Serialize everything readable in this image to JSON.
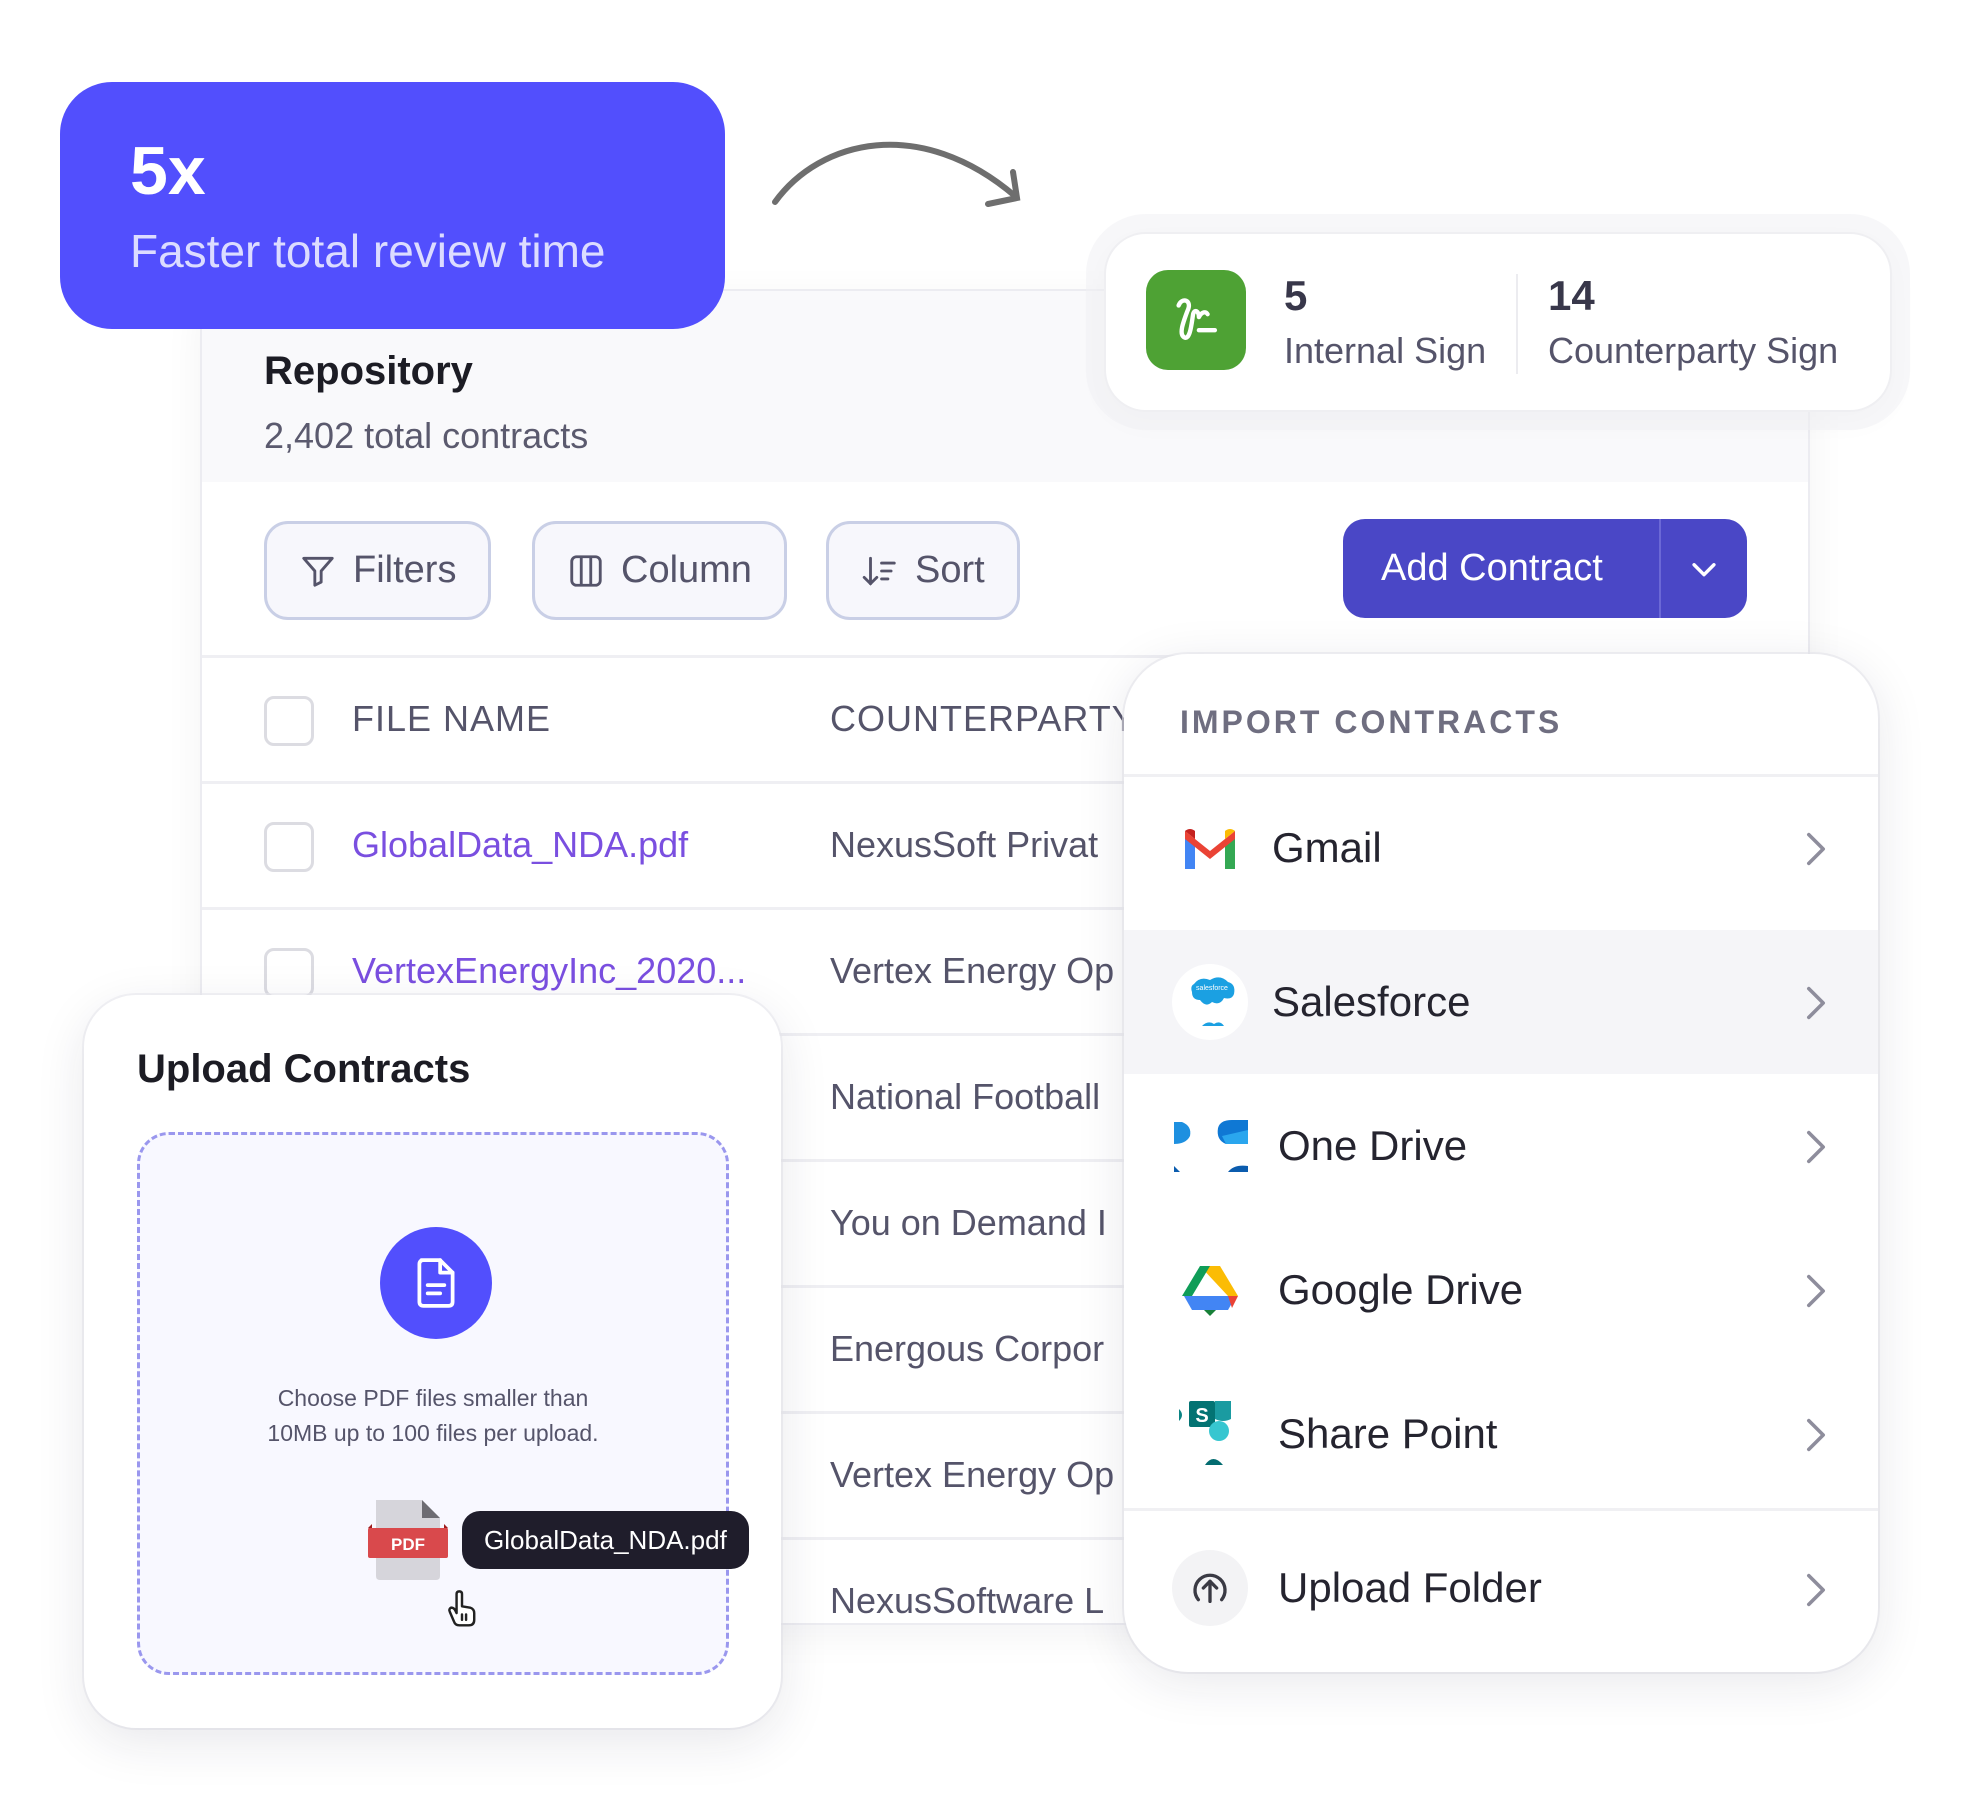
{
  "stat": {
    "value": "5x",
    "label": "Faster total review time",
    "color": "#524ffd"
  },
  "repository": {
    "title": "Repository",
    "subtitle": "2,402 total contracts",
    "toolbar": {
      "filters_label": "Filters",
      "column_label": "Column",
      "sort_label": "Sort",
      "add_label": "Add Contract"
    },
    "table": {
      "columns": [
        "FILE NAME",
        "COUNTERPARTY"
      ],
      "rows": [
        {
          "file": "GlobalData_NDA.pdf",
          "counterparty": "NexusSoft Privat"
        },
        {
          "file": "VertexEnergyInc_2020...",
          "counterparty": "Vertex Energy Op"
        },
        {
          "file": "",
          "counterparty": "National Football"
        },
        {
          "file": "",
          "counterparty": "You on Demand I"
        },
        {
          "file": "",
          "counterparty": "Energous Corpor"
        },
        {
          "file": "",
          "counterparty": "Vertex Energy Op"
        },
        {
          "file": "",
          "counterparty": "NexusSoftware L"
        }
      ]
    }
  },
  "signatures": {
    "internal": {
      "count": "5",
      "label": "Internal Sign"
    },
    "counterparty": {
      "count": "14",
      "label": "Counterparty Sign"
    },
    "icon_color": "#4ea234"
  },
  "import": {
    "heading": "IMPORT CONTRACTS",
    "items": [
      {
        "label": "Gmail",
        "icon": "gmail-icon"
      },
      {
        "label": "Salesforce",
        "icon": "salesforce-icon"
      },
      {
        "label": "One Drive",
        "icon": "onedrive-icon"
      },
      {
        "label": "Google Drive",
        "icon": "google-drive-icon"
      },
      {
        "label": "Share Point",
        "icon": "sharepoint-icon"
      },
      {
        "label": "Upload Folder",
        "icon": "upload-folder-icon"
      }
    ]
  },
  "upload": {
    "title": "Upload Contracts",
    "hint_line1": "Choose PDF files smaller than",
    "hint_line2": "10MB up to 100 files per upload.",
    "pdf_badge": "PDF",
    "dragged_file": "GlobalData_NDA.pdf"
  }
}
